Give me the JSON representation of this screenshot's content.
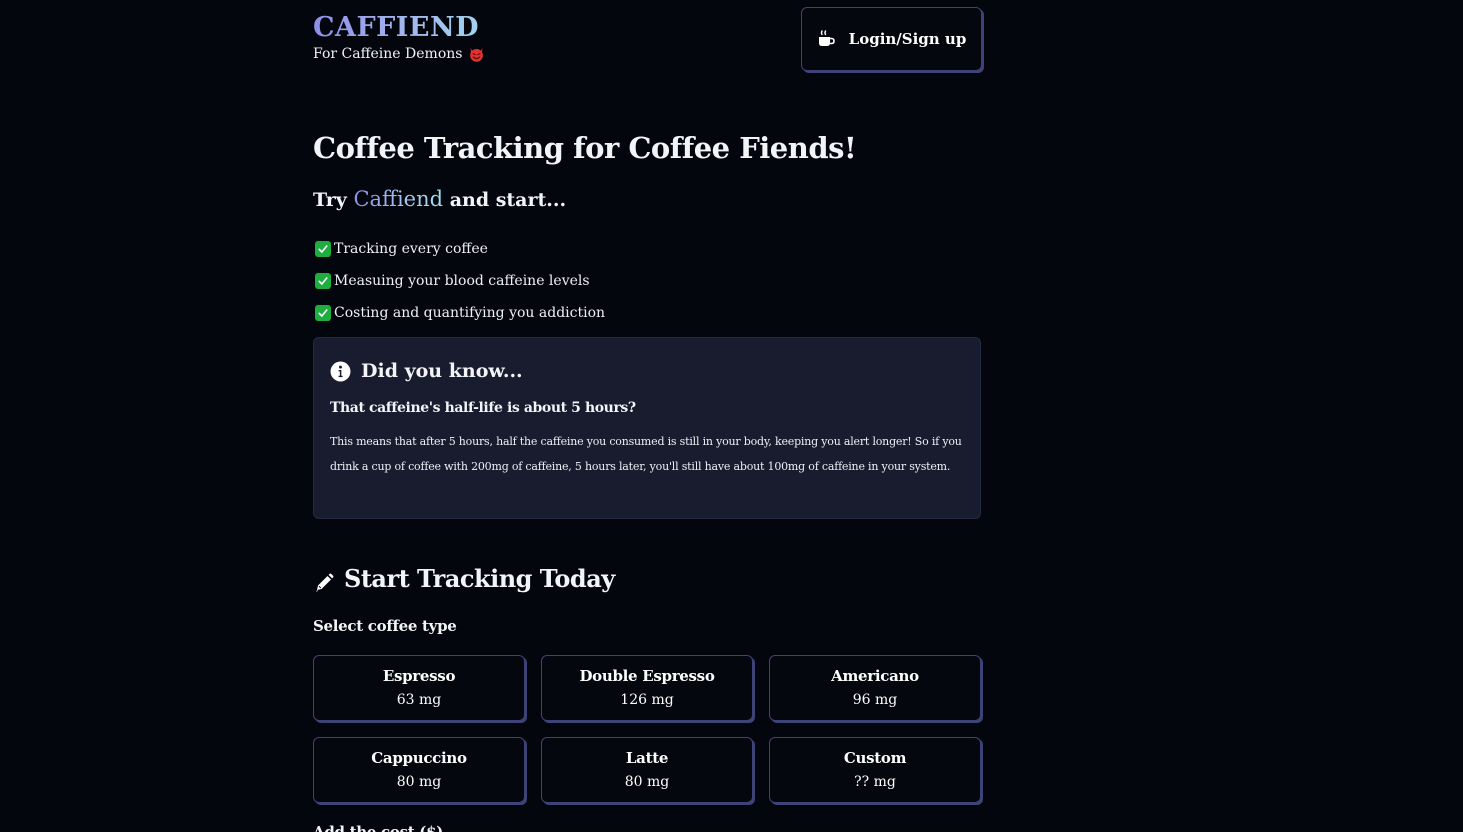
{
  "header": {
    "brand_title": "CAFFIEND",
    "tagline": "For Caffeine Demons",
    "tagline_icon": "smiling-devil-icon",
    "login_label": "Login/Sign up",
    "login_icon": "mug-hot-icon"
  },
  "hero": {
    "title": "Coffee Tracking for Coffee Fiends!",
    "sub_prefix": "Try",
    "sub_brand": "Caffiend",
    "sub_suffix": "and start...",
    "features": [
      "Tracking every coffee",
      "Measuing your blood caffeine levels",
      "Costing and quantifying you addiction"
    ]
  },
  "fact": {
    "icon": "info-circle-icon",
    "heading": "Did you know...",
    "question": "That caffeine's half-life is about 5 hours?",
    "body": "This means that after 5 hours, half the caffeine you consumed is still in your body, keeping you alert longer! So if you drink a cup of coffee with 200mg of caffeine, 5 hours later, you'll still have about 100mg of caffeine in your system."
  },
  "tracking": {
    "icon": "pencil-icon",
    "title": "Start Tracking Today",
    "select_label": "Select coffee type",
    "coffee_options": [
      {
        "name": "Espresso",
        "caffeine": "63 mg"
      },
      {
        "name": "Double Espresso",
        "caffeine": "126 mg"
      },
      {
        "name": "Americano",
        "caffeine": "96 mg"
      },
      {
        "name": "Cappuccino",
        "caffeine": "80 mg"
      },
      {
        "name": "Latte",
        "caffeine": "80 mg"
      },
      {
        "name": "Custom",
        "caffeine": "?? mg"
      }
    ],
    "cost_label": "Add the cost ($)"
  },
  "colors": {
    "background": "#04060d",
    "card": "#181c2e",
    "border": "#3e4377",
    "check": "#1fae3e",
    "devil": "#e1322f"
  }
}
